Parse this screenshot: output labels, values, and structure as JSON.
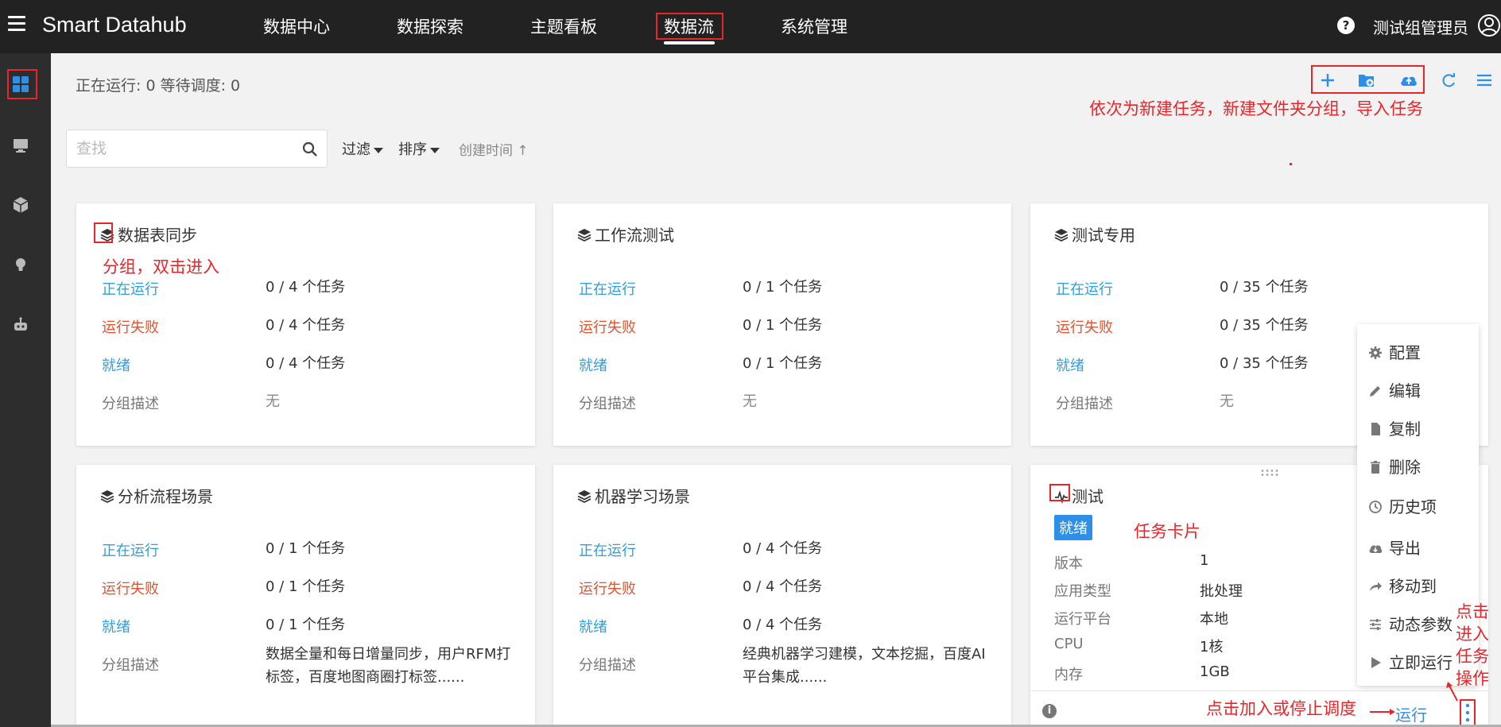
{
  "header": {
    "brand": "Smart Datahub",
    "nav": [
      "数据中心",
      "数据探索",
      "主题看板",
      "数据流",
      "系统管理"
    ],
    "active_nav": "数据流",
    "user": "测试组管理员"
  },
  "sidebar": {
    "icons": [
      "dashboard-icon",
      "monitor-icon",
      "cube-icon",
      "bulb-icon",
      "robot-icon"
    ],
    "active": "dashboard-icon"
  },
  "status": {
    "text": "正在运行: 0 等待调度: 0"
  },
  "toolbar": {
    "icons": [
      "plus-icon",
      "folder-add-icon",
      "cloud-upload-icon",
      "refresh-icon",
      "list-icon"
    ]
  },
  "search": {
    "placeholder": "查找"
  },
  "filters": {
    "filter_label": "过滤",
    "sort_label": "排序",
    "sort_field": "创建时间 ↑"
  },
  "annotations": {
    "toolbar_note": "依次为新建任务，新建文件夹分组，导入任务",
    "group_note": "分组，双击进入",
    "task_note": "任务卡片",
    "ops_note": [
      "点击",
      "进入",
      "任务",
      "操作"
    ],
    "schedule_note": "点击加入或停止调度"
  },
  "row_labels": {
    "running": "正在运行",
    "failed": "运行失败",
    "ready": "就绪",
    "desc": "分组描述"
  },
  "groups": [
    {
      "title": "数据表同步",
      "running": "0 / 4 个任务",
      "failed": "0 / 4 个任务",
      "ready": "0 / 4 个任务",
      "desc": "无"
    },
    {
      "title": "工作流测试",
      "running": "0 / 1 个任务",
      "failed": "0 / 1 个任务",
      "ready": "0 / 1 个任务",
      "desc": "无"
    },
    {
      "title": "测试专用",
      "running": "0 / 35 个任务",
      "failed": "0 / 35 个任务",
      "ready": "0 / 35 个任务",
      "desc": "无"
    },
    {
      "title": "分析流程场景",
      "running": "0 / 1 个任务",
      "failed": "0 / 1 个任务",
      "ready": "0 / 1 个任务",
      "desc": "数据全量和每日增量同步，用户RFM打标签，百度地图商圈打标签......"
    },
    {
      "title": "机器学习场景",
      "running": "0 / 4 个任务",
      "failed": "0 / 4 个任务",
      "ready": "0 / 4 个任务",
      "desc": "经典机器学习建模，文本挖掘，百度AI平台集成......"
    }
  ],
  "task": {
    "title": "测试",
    "badge": "就绪",
    "fields": [
      {
        "label": "版本",
        "value": "1"
      },
      {
        "label": "应用类型",
        "value": "批处理"
      },
      {
        "label": "运行平台",
        "value": "本地"
      },
      {
        "label": "CPU",
        "value": "1核"
      },
      {
        "label": "内存",
        "value": "1GB"
      }
    ],
    "run_label": "运行"
  },
  "context_menu": {
    "items": [
      {
        "label": "配置",
        "icon": "gear-icon"
      },
      {
        "label": "编辑",
        "icon": "pencil-icon"
      },
      {
        "label": "复制",
        "icon": "file-icon"
      },
      {
        "label": "删除",
        "icon": "trash-icon"
      },
      {
        "label": "历史项",
        "icon": "clock-icon"
      },
      {
        "label": "导出",
        "icon": "cloud-download-icon"
      },
      {
        "label": "移动到",
        "icon": "share-arrow-icon"
      },
      {
        "label": "动态参数",
        "icon": "sliders-icon"
      },
      {
        "label": "立即运行",
        "icon": "play-icon"
      }
    ]
  },
  "colors": {
    "topbar": "#222222",
    "sidebar": "#2d2d2d",
    "accent_blue": "#2d8fe8",
    "running_blue": "#2d9fe0",
    "failed_red": "#e2532d",
    "annotation_red": "#e8262a"
  }
}
